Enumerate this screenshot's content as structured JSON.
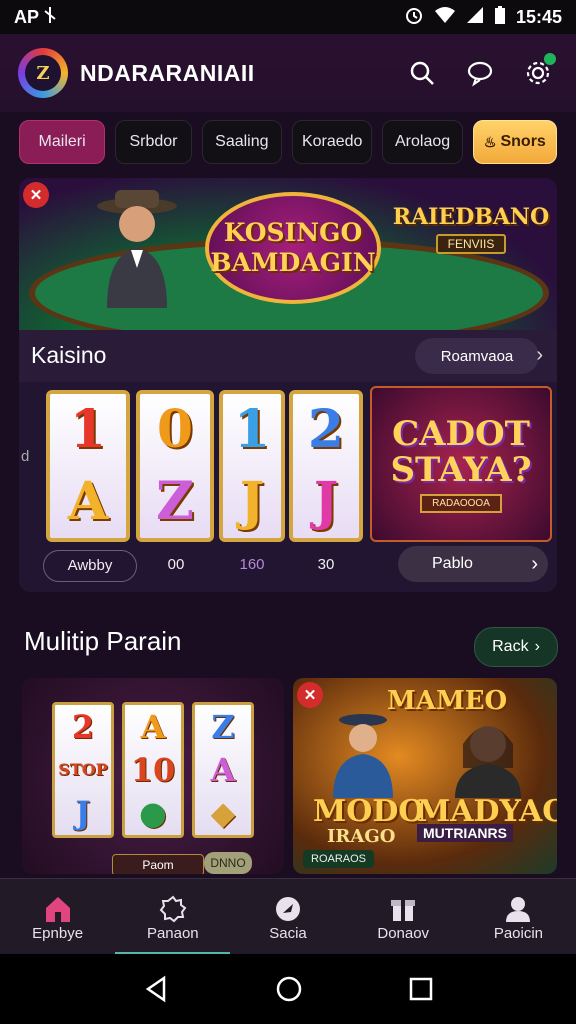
{
  "status_bar": {
    "app_label": "AP",
    "time": "15:45"
  },
  "header": {
    "app_name": "NDARARANIAII",
    "logo_text": "Z"
  },
  "tabs": [
    {
      "label": "Maileri",
      "active": true
    },
    {
      "label": "Srbdor"
    },
    {
      "label": "Saaling"
    },
    {
      "label": "Koraedo"
    },
    {
      "label": "Arolaog"
    },
    {
      "label": "Snors",
      "highlight": true
    }
  ],
  "banner": {
    "logo_line1": "KOSINGO",
    "logo_line2": "BAMDAGIN",
    "right_title": "RAIEDBANO",
    "right_subtitle": "FENVIIS"
  },
  "kasino": {
    "title": "Kaisino",
    "see_more": "Roamvaoa",
    "side_mark": "d",
    "reels": [
      {
        "top": "1",
        "bottom": "A",
        "top_color": "#e8362a",
        "bottom_color": "#f2b22c"
      },
      {
        "top": "0",
        "bottom": "Z",
        "top_color": "#f09a1c",
        "bottom_color": "#cc5fd8"
      },
      {
        "top": "1",
        "bottom": "J",
        "top_color": "#3aa0e6",
        "bottom_color": "#f2b22c"
      },
      {
        "top": "2",
        "bottom": "J",
        "top_color": "#3a7de6",
        "bottom_color": "#e03aa8"
      }
    ],
    "reel_labels": [
      "Awbby",
      "00",
      "160",
      "30"
    ],
    "promo": {
      "line1": "CADOT",
      "line2": "STAYA?",
      "sub": "RADAOOOA"
    },
    "play_label": "Pablo"
  },
  "section2": {
    "title": "Mulitip Parain",
    "button": "Rack",
    "left_card": {
      "reels": [
        {
          "top": "2",
          "mid": "STOP",
          "bottom": "J"
        },
        {
          "top": "A",
          "mid": "10",
          "bottom": "●"
        },
        {
          "top": "Z",
          "mid": "A",
          "bottom": "◆"
        }
      ],
      "button": "Paom",
      "button2": "DNNO"
    },
    "right_card": {
      "title": "MAMEO",
      "line1": "MODO",
      "line2": "MADYAO",
      "line3": "IRAGO",
      "line4": "MUTRIANRS",
      "tag": "ROARAOS"
    }
  },
  "bottom_nav": [
    {
      "label": "Epnbye",
      "icon": "home-icon",
      "active": true
    },
    {
      "label": "Panaon",
      "icon": "gear-icon"
    },
    {
      "label": "Sacia",
      "icon": "chip-icon"
    },
    {
      "label": "Donaov",
      "icon": "gift-icon"
    },
    {
      "label": "Paoicin",
      "icon": "profile-icon"
    }
  ],
  "colors": {
    "accent_pink": "#8a1c56",
    "gold": "#ffd36a",
    "home_pink": "#e14580",
    "nav_line": "#56b8a4"
  }
}
